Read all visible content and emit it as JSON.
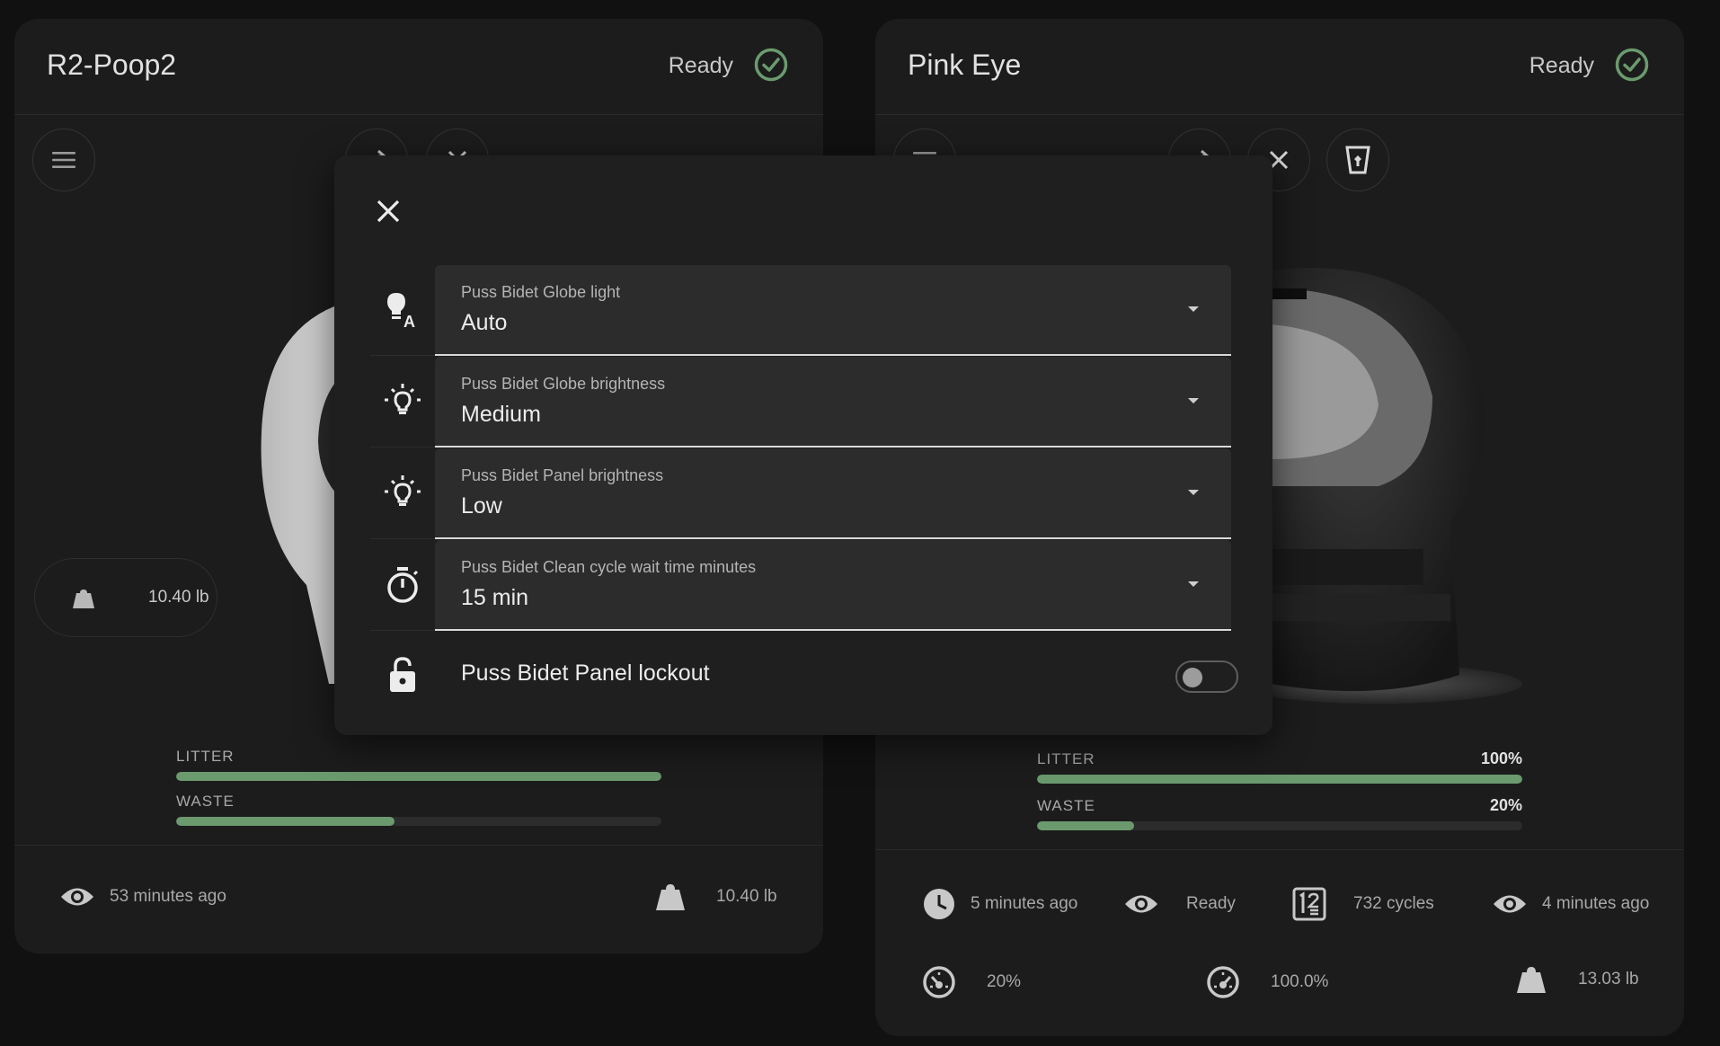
{
  "colors": {
    "accent_green": "#6b9a6e",
    "background": "#111111",
    "card": "#1c1c1c",
    "dialog": "#1f1f1f"
  },
  "left_card": {
    "title": "R2-Poop2",
    "status": "Ready",
    "weight_pill": "10.40 lb",
    "litter_label": "LITTER",
    "waste_label": "WASTE",
    "litter_level": 1.0,
    "waste_level": 0.45,
    "footer": [
      {
        "icon": "eye-icon",
        "text": "53 minutes ago"
      },
      {
        "icon": "weight-icon",
        "text": "10.40 lb"
      }
    ]
  },
  "right_card": {
    "title": "Pink Eye",
    "status": "Ready",
    "litter_label": "LITTER",
    "litter_pct": "100%",
    "waste_label": "WASTE",
    "waste_pct": "20%",
    "litter_level": 1.0,
    "waste_level": 0.2,
    "footer_row1": [
      {
        "icon": "clock-icon",
        "text": "5 minutes ago"
      },
      {
        "icon": "eye-icon",
        "text": "Ready"
      },
      {
        "icon": "counter-icon",
        "text": "732 cycles"
      },
      {
        "icon": "eye-icon",
        "text": "4 minutes ago"
      }
    ],
    "footer_row2": [
      {
        "icon": "gauge-icon",
        "text": "20%"
      },
      {
        "icon": "gauge-icon",
        "text": "100.0%"
      },
      {
        "icon": "weight-icon",
        "text": "13.03 lb"
      }
    ]
  },
  "dialog": {
    "rows": [
      {
        "icon": "lightbulb-auto-icon",
        "label": "Puss Bidet Globe light",
        "value": "Auto"
      },
      {
        "icon": "lightbulb-on-icon",
        "label": "Puss Bidet Globe brightness",
        "value": "Medium"
      },
      {
        "icon": "lightbulb-on-icon",
        "label": "Puss Bidet Panel brightness",
        "value": "Low"
      },
      {
        "icon": "timer-icon",
        "label": "Puss Bidet Clean cycle wait time minutes",
        "value": "15 min"
      }
    ],
    "toggle": {
      "icon": "lock-open-icon",
      "label": "Puss Bidet Panel lockout",
      "on": false
    }
  }
}
